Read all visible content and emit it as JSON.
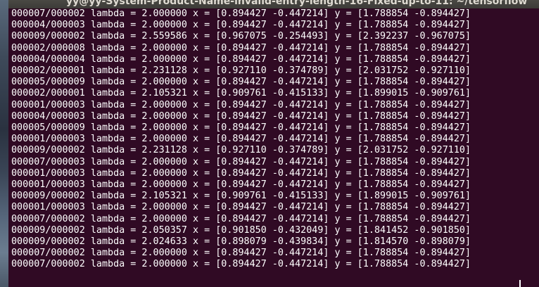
{
  "window": {
    "title": "yy@yy-System-Product-Name-invalid-entry-length-16-Fixed-up-to-11: ~/tensorflow"
  },
  "terminal": {
    "lines": [
      "000007/000002 lambda = 2.000000 x = [0.894427 -0.447214] y = [1.788854 -0.894427]",
      "000004/000003 lambda = 2.000000 x = [0.894427 -0.447214] y = [1.788854 -0.894427]",
      "000009/000002 lambda = 2.559586 x = [0.967075 -0.254493] y = [2.392237 -0.967075]",
      "000002/000008 lambda = 2.000000 x = [0.894427 -0.447214] y = [1.788854 -0.894427]",
      "000004/000004 lambda = 2.000000 x = [0.894427 -0.447214] y = [1.788854 -0.894427]",
      "000002/000001 lambda = 2.231128 x = [0.927110 -0.374789] y = [2.031752 -0.927110]",
      "000005/000009 lambda = 2.000000 x = [0.894427 -0.447214] y = [1.788854 -0.894427]",
      "000002/000001 lambda = 2.105321 x = [0.909761 -0.415133] y = [1.899015 -0.909761]",
      "000001/000003 lambda = 2.000000 x = [0.894427 -0.447214] y = [1.788854 -0.894427]",
      "000004/000003 lambda = 2.000000 x = [0.894427 -0.447214] y = [1.788854 -0.894427]",
      "000005/000009 lambda = 2.000000 x = [0.894427 -0.447214] y = [1.788854 -0.894427]",
      "000001/000003 lambda = 2.000000 x = [0.894427 -0.447214] y = [1.788854 -0.894427]",
      "000009/000002 lambda = 2.231128 x = [0.927110 -0.374789] y = [2.031752 -0.927110]",
      "000007/000003 lambda = 2.000000 x = [0.894427 -0.447214] y = [1.788854 -0.894427]",
      "000001/000003 lambda = 2.000000 x = [0.894427 -0.447214] y = [1.788854 -0.894427]",
      "000001/000003 lambda = 2.000000 x = [0.894427 -0.447214] y = [1.788854 -0.894427]",
      "000009/000002 lambda = 2.105321 x = [0.909761 -0.415133] y = [1.899015 -0.909761]",
      "000001/000003 lambda = 2.000000 x = [0.894427 -0.447214] y = [1.788854 -0.894427]",
      "000007/000002 lambda = 2.000000 x = [0.894427 -0.447214] y = [1.788854 -0.894427]",
      "000009/000002 lambda = 2.050357 x = [0.901850 -0.432049] y = [1.841452 -0.901850]",
      "000009/000002 lambda = 2.024633 x = [0.898079 -0.439834] y = [1.814570 -0.898079]",
      "000007/000002 lambda = 2.000000 x = [0.894427 -0.447214] y = [1.788854 -0.894427]",
      "000007/000002 lambda = 2.000000 x = [0.894427 -0.447214] y = [1.788854 -0.894427]"
    ]
  }
}
